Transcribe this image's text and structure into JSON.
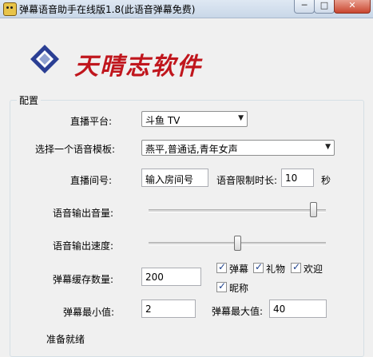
{
  "window": {
    "title": "弹幕语音助手在线版1.8(此语音弹幕免费)",
    "min": "─",
    "max": "□",
    "close": "✕"
  },
  "logo": {
    "brand_text": "天晴志软件",
    "mark_color": "#2b3f94",
    "brand_color": "#c0161d"
  },
  "config": {
    "group_title": "配置",
    "platform": {
      "label": "直播平台:",
      "value": "斗鱼 TV"
    },
    "template": {
      "label": "选择一个语音模板:",
      "value": "燕平,普通话,青年女声"
    },
    "room": {
      "label": "直播间号:",
      "value": "输入房间号"
    },
    "time_limit": {
      "label": "语音限制时长:",
      "value": "10",
      "unit": "秒"
    },
    "volume": {
      "label": "语音输出音量:",
      "level": 0.95
    },
    "speed": {
      "label": "语音输出速度:",
      "level": 0.5
    },
    "cache": {
      "label": "弹幕缓存数量:",
      "value": "200"
    },
    "min_val": {
      "label": "弹幕最小值:",
      "value": "2"
    },
    "max_val": {
      "label": "弹幕最大值:",
      "value": "40"
    },
    "checkboxes": [
      {
        "label": "弹幕",
        "checked": true
      },
      {
        "label": "礼物",
        "checked": true
      },
      {
        "label": "欢迎",
        "checked": true
      },
      {
        "label": "昵称",
        "checked": true
      }
    ]
  },
  "status": {
    "text": "准备就绪"
  }
}
